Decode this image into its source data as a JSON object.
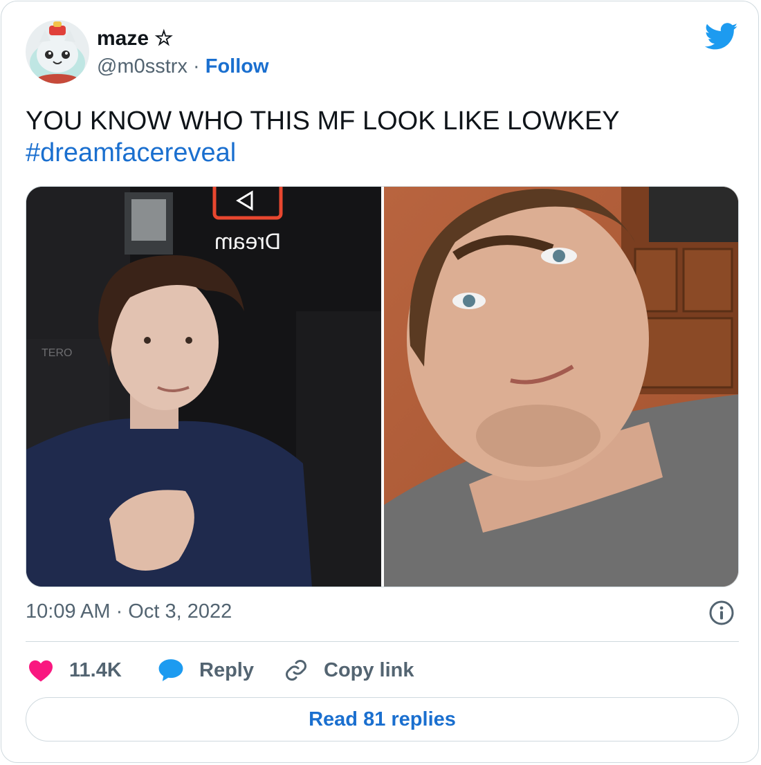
{
  "author": {
    "name": "maze ☆",
    "handle": "@m0sstrx",
    "separator": "·",
    "follow_label": "Follow"
  },
  "tweet": {
    "text": "YOU KNOW WHO THIS MF LOOK LIKE LOWKEY",
    "hashtag": "#dreamfacereveal"
  },
  "media": {
    "left_sign_text": "Dream",
    "left_chair_text": "TERO"
  },
  "meta": {
    "timestamp": "10:09 AM · Oct 3, 2022"
  },
  "actions": {
    "likes": "11.4K",
    "reply": "Reply",
    "copy_link": "Copy link"
  },
  "read_replies": "Read 81 replies",
  "colors": {
    "link": "#1a6fcf",
    "twitter_blue": "#1d9bf0",
    "heart": "#f91880",
    "text": "#0f1419",
    "muted": "#536471"
  }
}
